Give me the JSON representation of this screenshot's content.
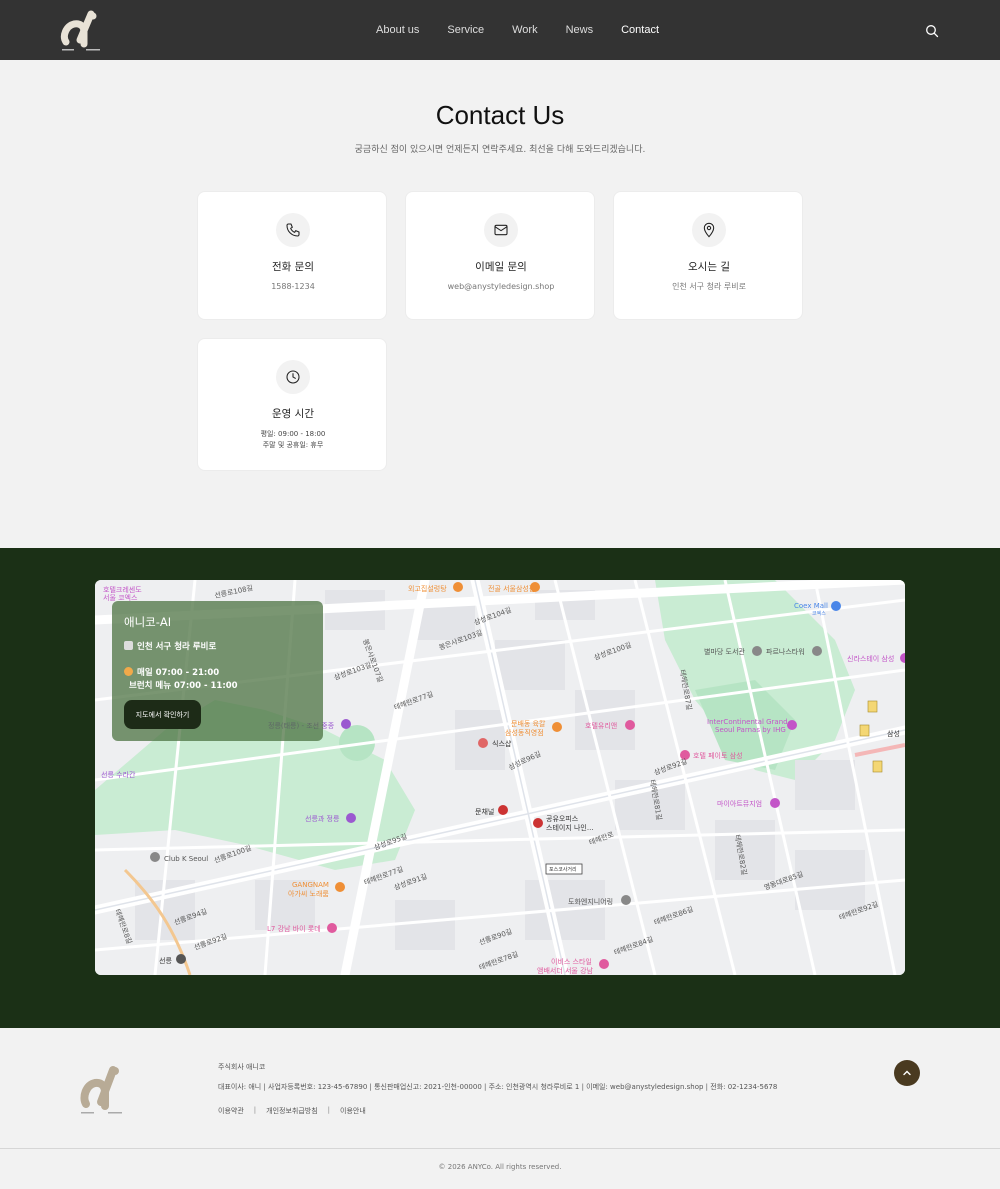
{
  "header": {
    "logo_text": "ai",
    "nav": [
      "About us",
      "Service",
      "Work",
      "News",
      "Contact"
    ]
  },
  "contact": {
    "title": "Contact Us",
    "subtitle": "궁금하신 점이 있으시면 언제든지 연락주세요. 최선을 다해 도와드리겠습니다.",
    "cards": [
      {
        "title": "전화 문의",
        "value": "1588-1234"
      },
      {
        "title": "이메일 문의",
        "value": "web@anystyledesign.shop"
      },
      {
        "title": "오시는 길",
        "value": "인천 서구 청라 루비로"
      },
      {
        "title": "운영 시간",
        "value": "평일: 09:00 - 18:00",
        "value2": "주말 및 공휴일: 휴무"
      }
    ]
  },
  "map": {
    "overlay": {
      "title": "애니코-AI",
      "address": "인천 서구 청라 루비로",
      "hours1": "매일 07:00 - 21:00",
      "hours2": "브런치 메뉴 07:00 - 11:00",
      "button": "지도에서 확인하기"
    },
    "labels": {
      "coex": "Coex Mall",
      "coex_sub": "코엑스",
      "library": "별마당 도서관",
      "tower": "파르나스타워",
      "intercon": "InterContinental Grand",
      "intercon2": "Seoul Parnas by IHG",
      "hotelpeyto": "호텔 페이토 삼성",
      "myart": "마이아트뮤지엄",
      "hotelglass": "호텔유리앤",
      "munbae": "문배동 육칼",
      "munbae2": "삼성동직영점",
      "siksik": "식스샵",
      "munchae": "문채널",
      "gongyu": "공유오피스",
      "gongyu2": "스테이지 나인...",
      "dohwa": "도화엔지니어링",
      "posco": "포스코사거리",
      "jeongreung": "정릉(태릉) - 조선 중종",
      "seonreung": "선릉과 정릉",
      "clubk": "Club K Seoul",
      "gangnam": "GANGNAM",
      "gangnam2": "아가씨 노래룸",
      "l7": "L7 강남 바이 롯데",
      "ibis": "이비스 스타일",
      "ibis2": "앰배서더 서울 강남",
      "hotelcresc": "호텔크레센도",
      "hotelcresc2": "서울 코엑스",
      "suran": "선릉 수라간",
      "seonreung_st": "선릉",
      "ssq": "신라스테이 삼성",
      "samsung": "삼성",
      "ogo": "외고집설렁탕",
      "jeongol": "전골 서울삼성점"
    },
    "roads": [
      "선릉로108길",
      "봉은사로107길",
      "봉은사로103길",
      "삼성로104길",
      "테헤란로87길",
      "삼성로103길",
      "삼성로100길",
      "테헤란로77길",
      "삼성로95길",
      "테헤란로81길",
      "테헤란로",
      "삼성로92길",
      "삼성로96길",
      "선릉로100길",
      "테헤란로8길",
      "테헤란로77길",
      "선릉로94길",
      "선릉로92길",
      "삼성로91길",
      "테헤란로86길",
      "영동대로85길",
      "테헤란로92길",
      "테헤란로84길",
      "선릉로90길",
      "테헤란로78길",
      "테헤란로82길"
    ]
  },
  "footer": {
    "company": "주식회사 애니코",
    "info": "대표이사: 애니 | 사업자등록번호: 123-45-67890 | 통신판매업신고: 2021-인천-00000 | 주소: 인천광역시 청라루비로 1 | 이메일: web@anystyledesign.shop | 전화: 02-1234-5678",
    "links": [
      "이용약관",
      "개인정보취급방침",
      "이용안내"
    ],
    "copyright": "© 2026 ANYCo. All rights reserved."
  }
}
